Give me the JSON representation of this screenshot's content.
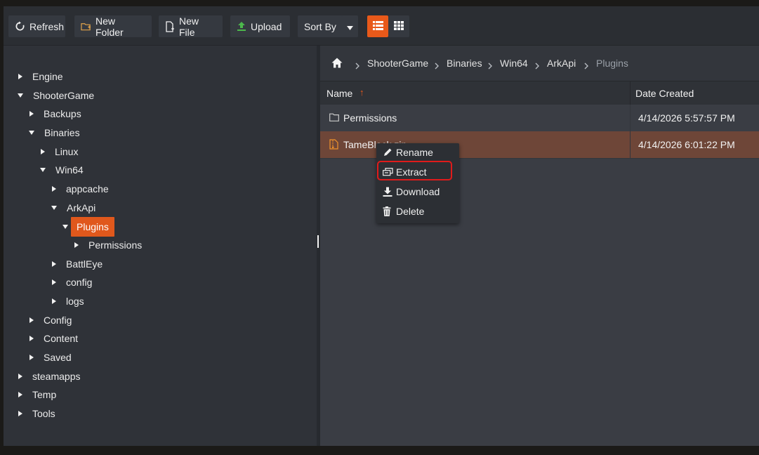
{
  "toolbar": {
    "refresh_label": "Refresh",
    "new_folder_label": "New Folder",
    "new_file_label": "New File",
    "upload_label": "Upload",
    "sort_by_label": "Sort By"
  },
  "tree": {
    "items": [
      {
        "label": "Engine",
        "expanded": false
      },
      {
        "label": "ShooterGame",
        "expanded": true
      },
      {
        "label": "Backups",
        "expanded": false
      },
      {
        "label": "Binaries",
        "expanded": true
      },
      {
        "label": "Linux",
        "expanded": false
      },
      {
        "label": "Win64",
        "expanded": true
      },
      {
        "label": "appcache",
        "expanded": false
      },
      {
        "label": "ArkApi",
        "expanded": true
      },
      {
        "label": "Plugins",
        "expanded": true,
        "selected": true
      },
      {
        "label": "Permissions",
        "expanded": false
      },
      {
        "label": "BattlEye",
        "expanded": false
      },
      {
        "label": "config",
        "expanded": false
      },
      {
        "label": "logs",
        "expanded": false
      },
      {
        "label": "Config",
        "expanded": false
      },
      {
        "label": "Content",
        "expanded": false
      },
      {
        "label": "Saved",
        "expanded": false
      },
      {
        "label": "steamapps",
        "expanded": false
      },
      {
        "label": "Temp",
        "expanded": false
      },
      {
        "label": "Tools",
        "expanded": false
      }
    ]
  },
  "breadcrumb": [
    "ShooterGame",
    "Binaries",
    "Win64",
    "ArkApi",
    "Plugins"
  ],
  "grid": {
    "col_name": "Name",
    "col_date": "Date Created",
    "sort_indicator": "↑",
    "rows": [
      {
        "name": "Permissions",
        "type": "folder",
        "date": "4/14/2026 5:57:57 PM"
      },
      {
        "name": "TameBlock.zip",
        "type": "zip",
        "date": "4/14/2026 6:01:22 PM"
      }
    ]
  },
  "context_menu": {
    "rename": "Rename",
    "extract": "Extract",
    "download": "Download",
    "delete": "Delete"
  },
  "colors": {
    "accent": "#e8591a",
    "selected_row": "#6e4638",
    "highlight_outline": "#e01b1b"
  }
}
